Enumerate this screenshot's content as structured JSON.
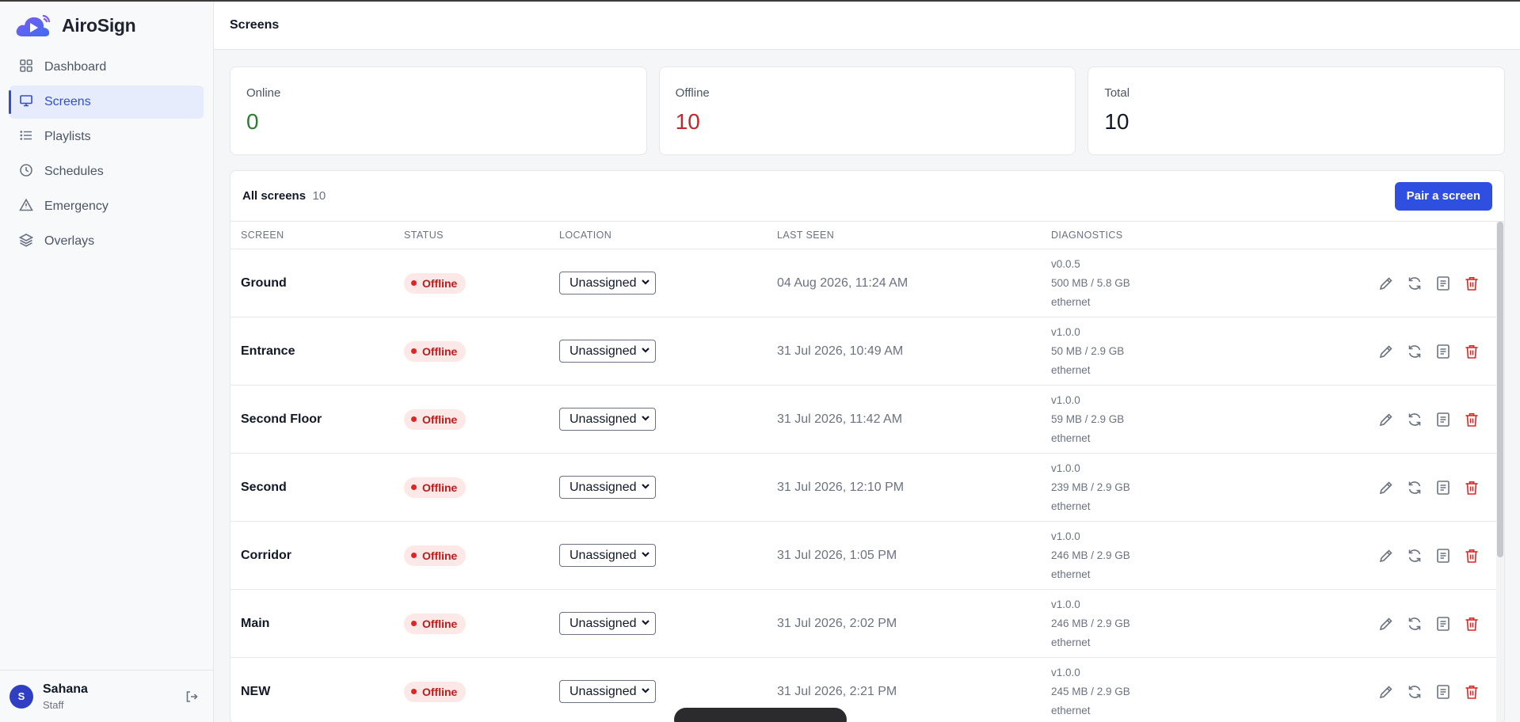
{
  "brand": {
    "name": "AiroSign"
  },
  "sidebar": {
    "items": [
      {
        "label": "Dashboard",
        "icon": "grid-icon"
      },
      {
        "label": "Screens",
        "icon": "monitor-icon"
      },
      {
        "label": "Playlists",
        "icon": "list-icon"
      },
      {
        "label": "Schedules",
        "icon": "clock-icon"
      },
      {
        "label": "Emergency",
        "icon": "alert-triangle-icon"
      },
      {
        "label": "Overlays",
        "icon": "layers-icon"
      }
    ],
    "active": "Screens"
  },
  "user": {
    "initial": "S",
    "name": "Sahana",
    "role": "Staff"
  },
  "header": {
    "title": "Screens"
  },
  "stats": {
    "online": {
      "label": "Online",
      "value": "0",
      "color": "#2e7d32"
    },
    "offline": {
      "label": "Offline",
      "value": "10",
      "color": "#c0282d"
    },
    "total": {
      "label": "Total",
      "value": "10",
      "color": "#111827"
    }
  },
  "table": {
    "title": "All screens",
    "count": "10",
    "pair_button": "Pair a screen",
    "columns": {
      "screen": "SCREEN",
      "status": "STATUS",
      "location": "LOCATION",
      "last_seen": "LAST SEEN",
      "diagnostics": "DIAGNOSTICS"
    },
    "rows": [
      {
        "name": "Ground",
        "status": "Offline",
        "location": "Unassigned",
        "last_seen": "04 Aug 2026, 11:24 AM",
        "version": "v0.0.5",
        "storage": "500 MB / 5.8 GB",
        "network": "ethernet"
      },
      {
        "name": "Entrance",
        "status": "Offline",
        "location": "Unassigned",
        "last_seen": "31 Jul 2026, 10:49 AM",
        "version": "v1.0.0",
        "storage": "50 MB / 2.9 GB",
        "network": "ethernet"
      },
      {
        "name": "Second Floor",
        "status": "Offline",
        "location": "Unassigned",
        "last_seen": "31 Jul 2026, 11:42 AM",
        "version": "v1.0.0",
        "storage": "59 MB / 2.9 GB",
        "network": "ethernet"
      },
      {
        "name": "Second",
        "status": "Offline",
        "location": "Unassigned",
        "last_seen": "31 Jul 2026, 12:10 PM",
        "version": "v1.0.0",
        "storage": "239 MB / 2.9 GB",
        "network": "ethernet"
      },
      {
        "name": "Corridor",
        "status": "Offline",
        "location": "Unassigned",
        "last_seen": "31 Jul 2026, 1:05 PM",
        "version": "v1.0.0",
        "storage": "246 MB / 2.9 GB",
        "network": "ethernet"
      },
      {
        "name": "Main",
        "status": "Offline",
        "location": "Unassigned",
        "last_seen": "31 Jul 2026, 2:02 PM",
        "version": "v1.0.0",
        "storage": "246 MB / 2.9 GB",
        "network": "ethernet"
      },
      {
        "name": "NEW",
        "status": "Offline",
        "location": "Unassigned",
        "last_seen": "31 Jul 2026, 2:21 PM",
        "version": "v1.0.0",
        "storage": "245 MB / 2.9 GB",
        "network": "ethernet"
      }
    ],
    "row_actions": [
      "edit-icon",
      "refresh-icon",
      "logs-icon",
      "delete-icon"
    ]
  }
}
